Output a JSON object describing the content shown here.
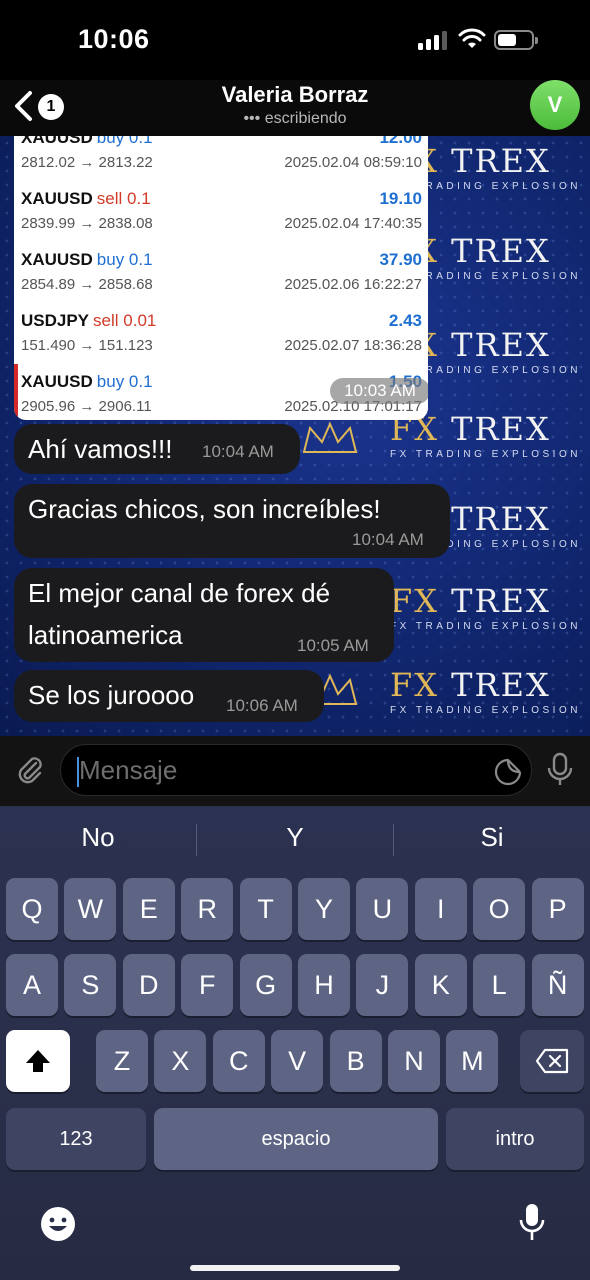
{
  "status_bar": {
    "time": "10:06"
  },
  "header": {
    "back_count": "1",
    "contact_name": "Valeria Borraz",
    "contact_status": "••• escribiendo",
    "avatar_initial": "V"
  },
  "background": {
    "logo_title_fx": "FX",
    "logo_title_rest": "TREX",
    "logo_subtitle": "FX TRADING EXPLOSION"
  },
  "trade_card": {
    "time": "10:03 AM",
    "rows": [
      {
        "symbol": "XAUUSD",
        "side": "buy 0.1",
        "profit": "12.00",
        "prices": "2812.02 → 2813.22",
        "timestamp": "2025.02.04 08:59:10"
      },
      {
        "symbol": "XAUUSD",
        "side": "sell 0.1",
        "profit": "19.10",
        "prices": "2839.99 → 2838.08",
        "timestamp": "2025.02.04 17:40:35"
      },
      {
        "symbol": "XAUUSD",
        "side": "buy 0.1",
        "profit": "37.90",
        "prices": "2854.89 → 2858.68",
        "timestamp": "2025.02.06 16:22:27"
      },
      {
        "symbol": "USDJPY",
        "side": "sell 0.01",
        "profit": "2.43",
        "prices": "151.490 → 151.123",
        "timestamp": "2025.02.07 18:36:28"
      },
      {
        "symbol": "XAUUSD",
        "side": "buy 0.1",
        "profit": "1.50",
        "prices": "2905.96 → 2906.11",
        "timestamp": "2025.02.10 17:01:17"
      }
    ]
  },
  "messages": [
    {
      "text": "Ahí vamos!!!",
      "time": "10:04 AM"
    },
    {
      "text": "Gracias chicos, son increíbles!",
      "time": "10:04 AM"
    },
    {
      "line1": "El mejor canal de forex dé",
      "line2": "latinoamerica",
      "time": "10:05 AM"
    },
    {
      "text": "Se los juroooo",
      "time": "10:06 AM"
    }
  ],
  "input": {
    "placeholder": "Mensaje"
  },
  "keyboard": {
    "suggestions": [
      "No",
      "Y",
      "Si"
    ],
    "row1": [
      "Q",
      "W",
      "E",
      "R",
      "T",
      "Y",
      "U",
      "I",
      "O",
      "P"
    ],
    "row2": [
      "A",
      "S",
      "D",
      "F",
      "G",
      "H",
      "J",
      "K",
      "L",
      "Ñ"
    ],
    "row3": [
      "Z",
      "X",
      "C",
      "V",
      "B",
      "N",
      "M"
    ],
    "numbers_key": "123",
    "space_key": "espacio",
    "return_key": "intro"
  },
  "icons": {
    "back": "chevron-left-icon",
    "attach": "paperclip-icon",
    "sticker": "sticker-icon",
    "mic": "microphone-icon",
    "shift": "shift-icon",
    "delete": "backspace-icon",
    "emoji": "emoji-icon",
    "dictation": "dictation-mic-icon"
  },
  "colors": {
    "buy": "#1f6fd1",
    "sell": "#d23a2a",
    "avatar": "#5cc84a",
    "logo_gold": "#e0b757"
  }
}
